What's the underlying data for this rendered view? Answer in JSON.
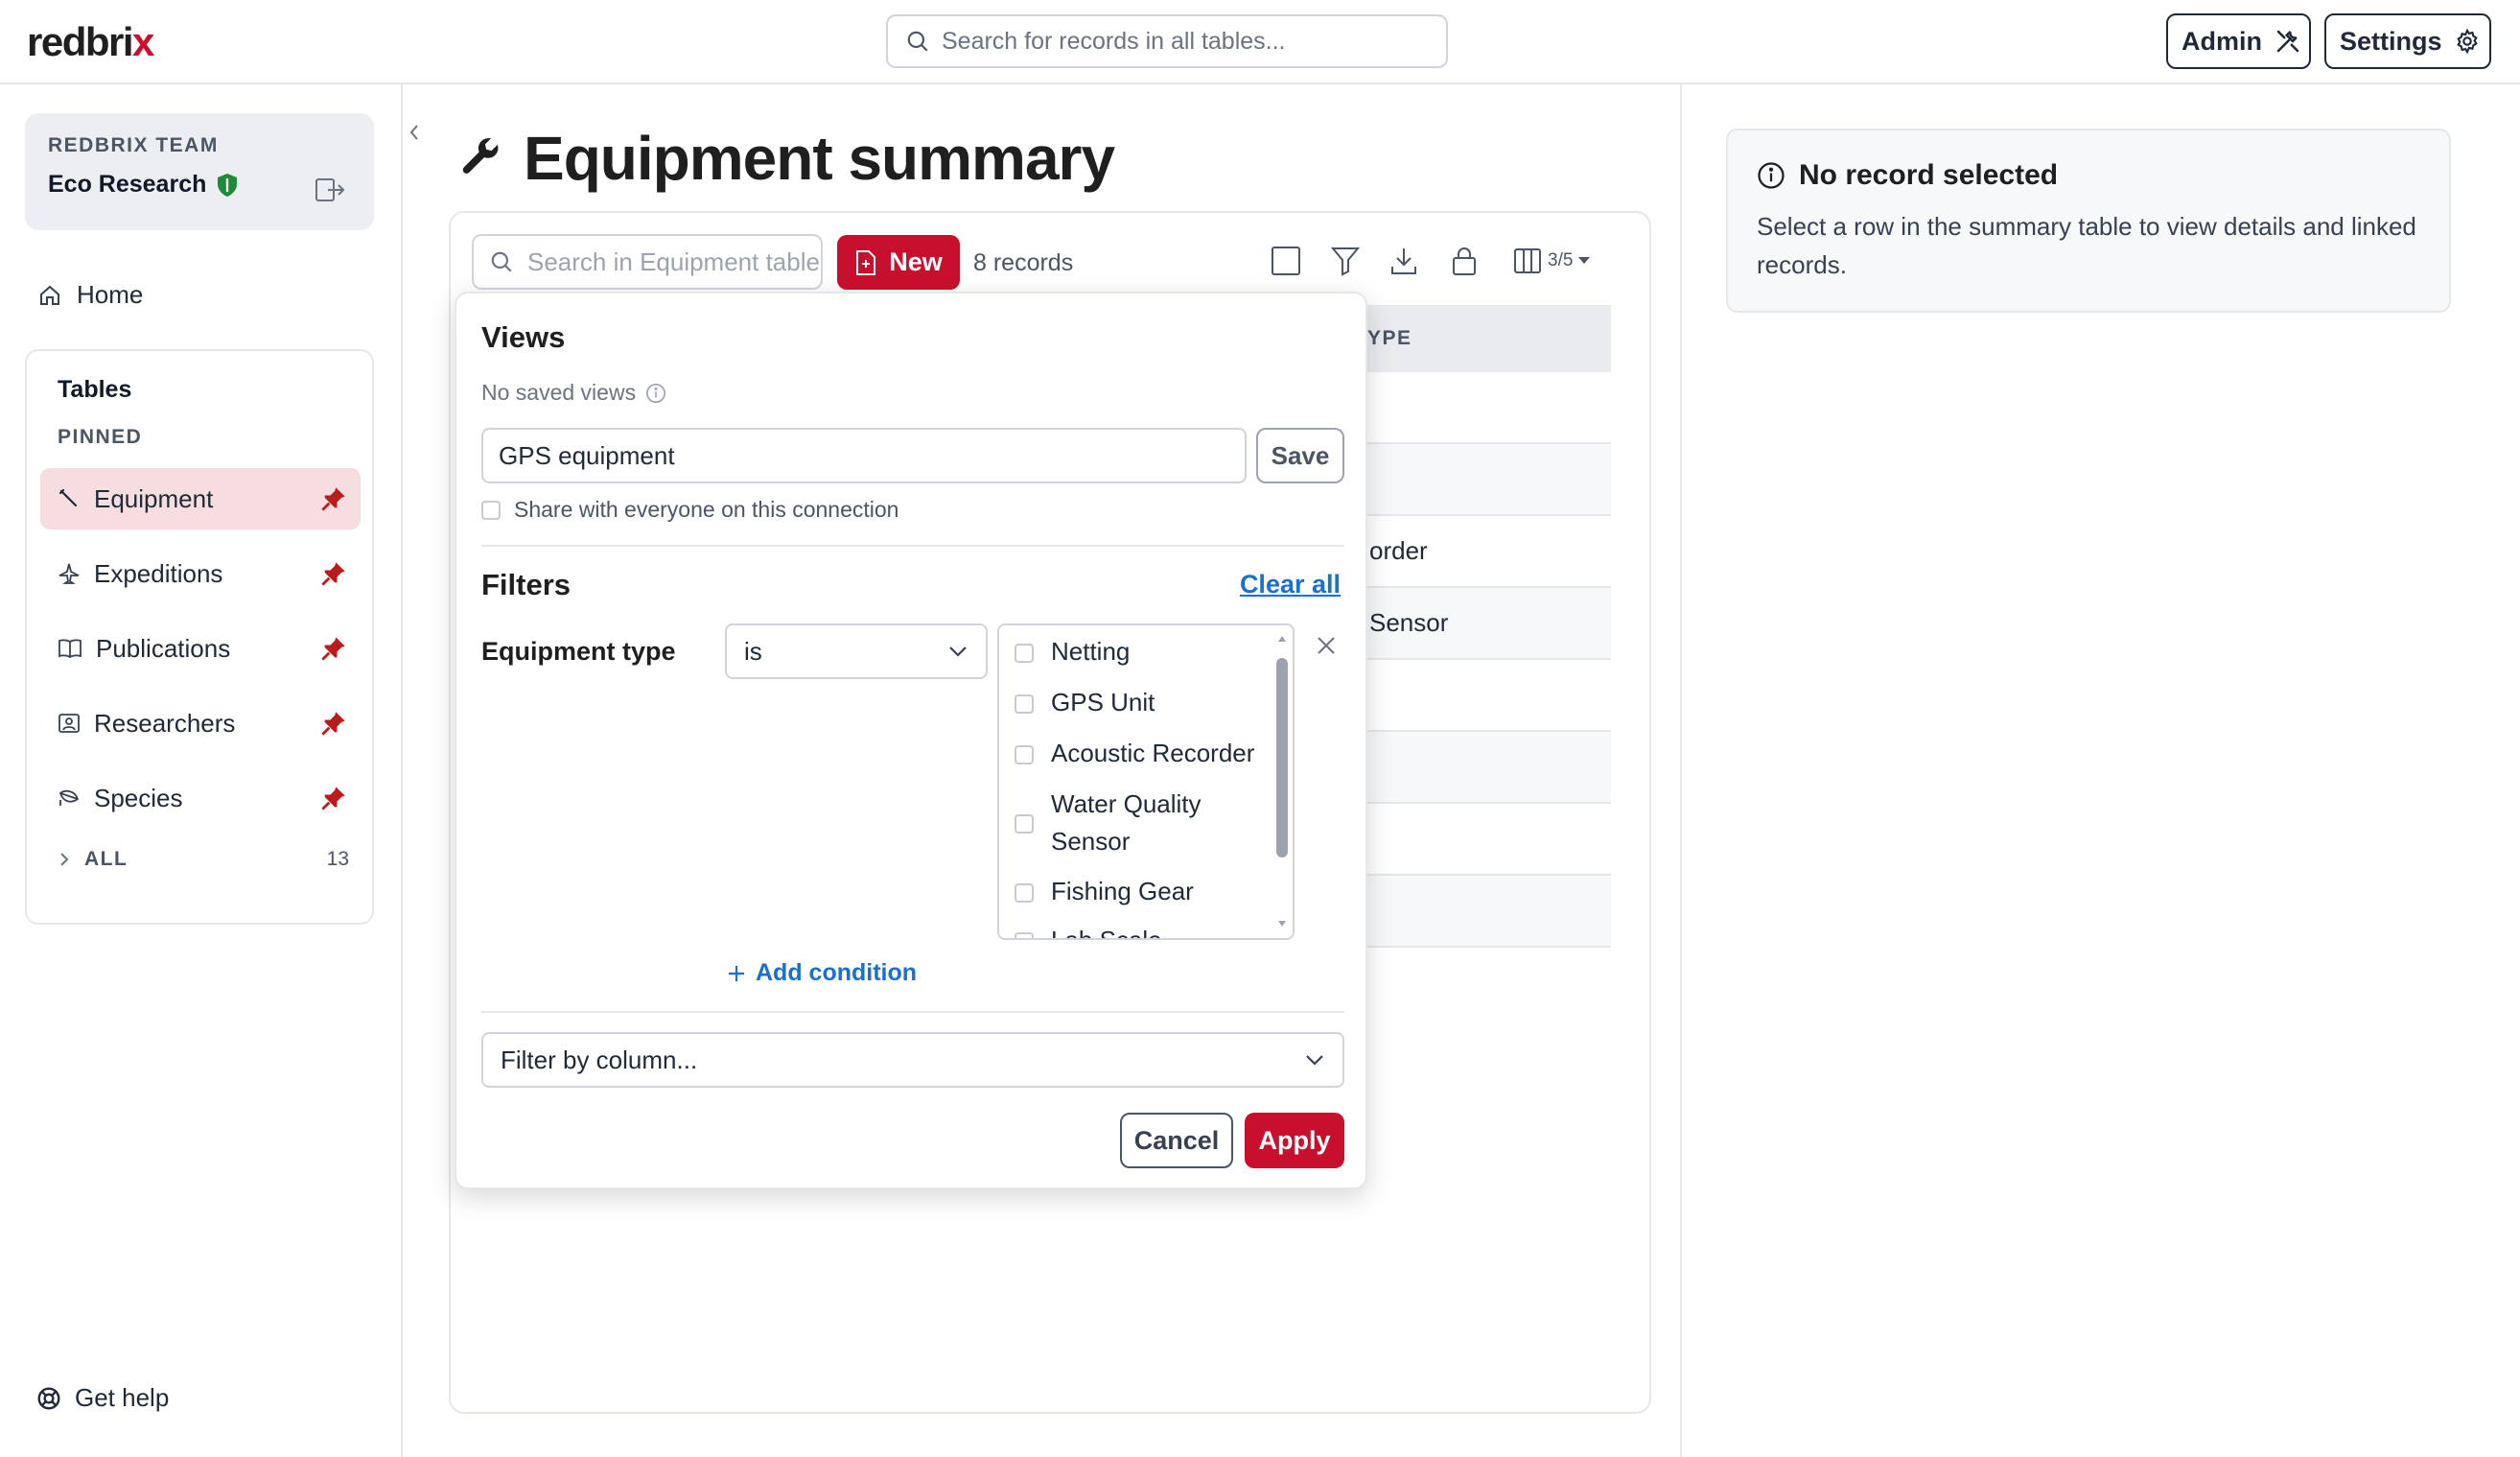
{
  "app": {
    "logo_main": "redbri",
    "logo_x": "x",
    "search_placeholder": "Search for records in all tables...",
    "admin_label": "Admin",
    "settings_label": "Settings"
  },
  "sidebar": {
    "team_label": "REDBRIX TEAM",
    "team_name": "Eco Research",
    "home_label": "Home",
    "tables_title": "Tables",
    "pinned_label": "PINNED",
    "items": [
      {
        "label": "Equipment",
        "icon": "wrench-icon",
        "active": true
      },
      {
        "label": "Expeditions",
        "icon": "plane-icon",
        "active": false
      },
      {
        "label": "Publications",
        "icon": "book-icon",
        "active": false
      },
      {
        "label": "Researchers",
        "icon": "badge-icon",
        "active": false
      },
      {
        "label": "Species",
        "icon": "leaf-icon",
        "active": false
      }
    ],
    "all_label": "ALL",
    "all_count": "13",
    "help_label": "Get help"
  },
  "main": {
    "title": "Equipment summary",
    "search_placeholder": "Search in Equipment table",
    "new_label": "New",
    "records_count": "8 records",
    "columns_label": "3/5",
    "column_header_fragment": "YPE",
    "rows": [
      "",
      "",
      "order",
      "Sensor",
      "",
      "",
      "",
      ""
    ]
  },
  "details": {
    "title": "No record selected",
    "text": "Select a row in the summary table to view details and linked records."
  },
  "popover": {
    "views_title": "Views",
    "no_views": "No saved views",
    "view_name_value": "GPS equipment",
    "save_label": "Save",
    "share_label": "Share with everyone on this connection",
    "filters_title": "Filters",
    "clear_all": "Clear all",
    "condition_column": "Equipment type",
    "operator": "is",
    "values": [
      {
        "label": "Netting",
        "checked": false
      },
      {
        "label": "GPS Unit",
        "checked": false
      },
      {
        "label": "Acoustic Recorder",
        "checked": false
      },
      {
        "label": "Water Quality Sensor",
        "checked": false
      },
      {
        "label": "Fishing Gear",
        "checked": false
      },
      {
        "label": "Lab Scale",
        "checked": false
      }
    ],
    "add_condition": "Add condition",
    "filter_by_column_placeholder": "Filter by column...",
    "cancel_label": "Cancel",
    "apply_label": "Apply"
  },
  "colors": {
    "brand": "#c8102e",
    "link": "#1a6fd1",
    "active_row": "#f6dde0"
  }
}
